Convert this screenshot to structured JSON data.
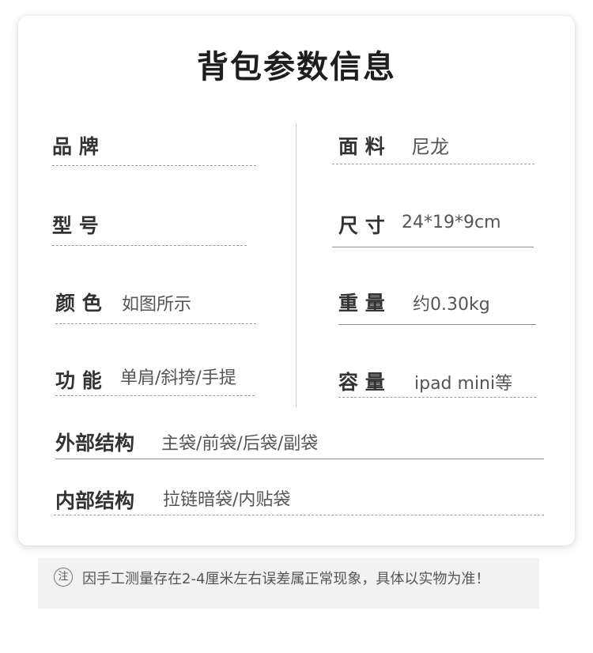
{
  "title": "背包参数信息",
  "specs": {
    "brand": {
      "label": "品 牌",
      "value": ""
    },
    "material": {
      "label": "面 料",
      "value": "尼龙"
    },
    "model": {
      "label": "型 号",
      "value": ""
    },
    "size": {
      "label": "尺 寸",
      "value": "24*19*9cm"
    },
    "color": {
      "label": "颜 色",
      "value": "如图所示"
    },
    "weight": {
      "label": "重 量",
      "value": "约0.30kg"
    },
    "function": {
      "label": "功 能",
      "value": "单肩/斜挎/手提"
    },
    "capacity": {
      "label": "容 量",
      "value": "ipad mini等"
    },
    "exterior": {
      "label": "外部结构",
      "value": "主袋/前袋/后袋/副袋"
    },
    "interior": {
      "label": "内部结构",
      "value": "拉链暗袋/内贴袋"
    }
  },
  "note": {
    "icon_text": "注",
    "text": "因手工测量存在2-4厘米左右误差属正常现象，具体以实物为准！"
  }
}
